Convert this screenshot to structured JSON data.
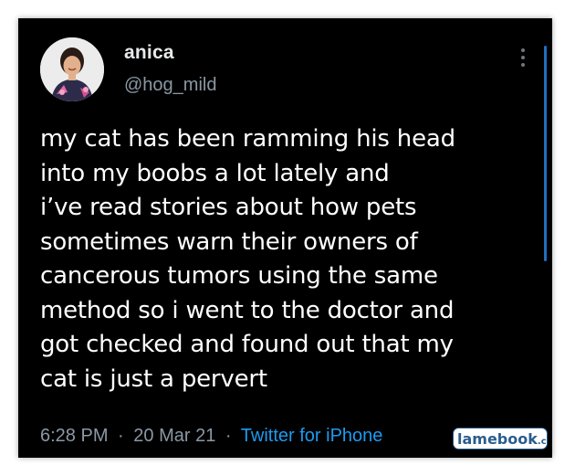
{
  "user": {
    "name": "anica",
    "handle": "@hog_mild"
  },
  "tweet": {
    "lines": [
      "my cat has been ramming his head",
      "into my boobs a lot lately and",
      "i’ve read stories about how pets",
      "sometimes warn their owners of",
      "cancerous tumors using the same",
      "method so i went to the doctor and",
      "got checked and found out that my",
      "cat is just a pervert"
    ]
  },
  "meta": {
    "time": "6:28 PM",
    "date": "20 Mar 21",
    "separator": "·",
    "source": "Twitter for iPhone"
  },
  "watermark": {
    "brand": "lamebook",
    "suffix": ".com"
  },
  "icons": {
    "menu": "more-vertical-icon",
    "avatar": "profile-photo"
  },
  "colors": {
    "background": "#000000",
    "text": "#ffffff",
    "secondary": "#8b98a5",
    "link": "#1d9bf0"
  }
}
